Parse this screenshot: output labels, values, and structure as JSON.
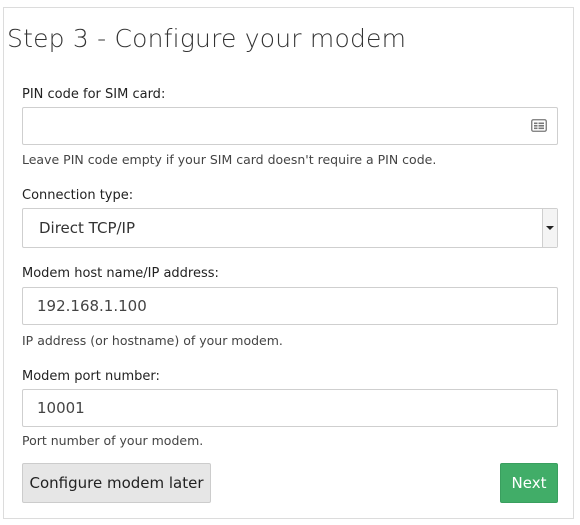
{
  "page": {
    "title": "Step 3 - Configure your modem"
  },
  "pin": {
    "label": "PIN code for SIM card:",
    "value": "",
    "icon": "id-card-icon",
    "help": "Leave PIN code empty if your SIM card doesn't require a PIN code."
  },
  "connection": {
    "label": "Connection type:",
    "selected": "Direct TCP/IP"
  },
  "host": {
    "label": "Modem host name/IP address:",
    "value": "192.168.1.100",
    "help": "IP address (or hostname) of your modem."
  },
  "port": {
    "label": "Modem port number:",
    "value": "10001",
    "help": "Port number of your modem."
  },
  "actions": {
    "later_label": "Configure modem later",
    "next_label": "Next"
  },
  "colors": {
    "next_button_bg": "#41ad68",
    "secondary_button_bg": "#e6e6e6"
  }
}
